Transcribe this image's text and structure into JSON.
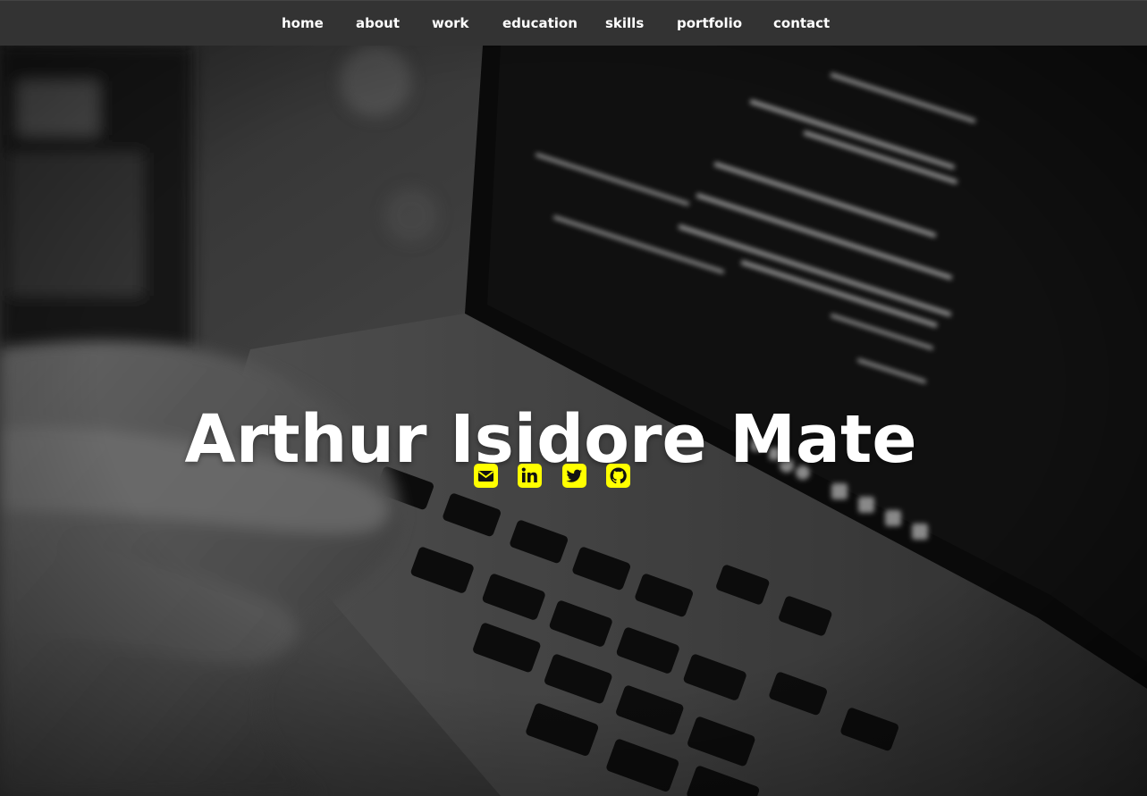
{
  "nav": {
    "items": [
      {
        "label": "home"
      },
      {
        "label": "about"
      },
      {
        "label": "work"
      },
      {
        "label": "education"
      },
      {
        "label": "skills"
      },
      {
        "label": "portfolio"
      },
      {
        "label": "contact"
      }
    ]
  },
  "hero": {
    "title": "Arthur Isidore Mate"
  },
  "socials": [
    {
      "icon": "envelope-icon"
    },
    {
      "icon": "linkedin-icon"
    },
    {
      "icon": "twitter-icon"
    },
    {
      "icon": "github-icon"
    }
  ],
  "colors": {
    "nav_bg": "#333333",
    "nav_text": "#ffffff",
    "title_text": "#ffffff",
    "social_accent": "#ffff00"
  }
}
